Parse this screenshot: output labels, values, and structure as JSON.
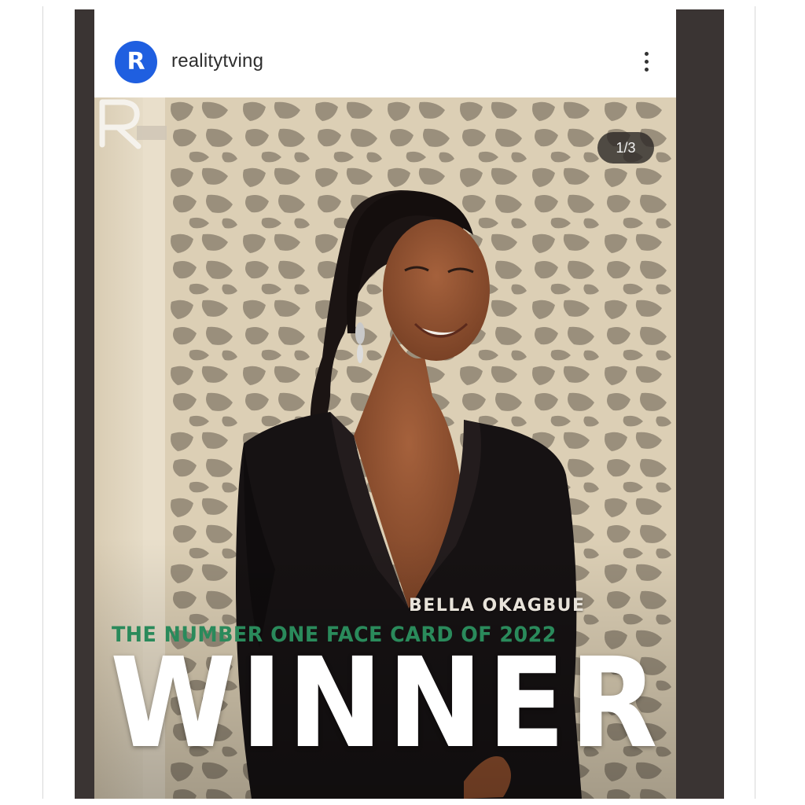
{
  "post": {
    "username": "realitytving",
    "avatar_letter": "R",
    "avatar_color": "#1f5fe0",
    "more_icon": "more-vertical-icon"
  },
  "media": {
    "slide_counter": "1/3",
    "name_caption": "BELLA OKAGBUE",
    "tagline": "THE NUMBER ONE FACE CARD OF 2022",
    "headline": "WINNER",
    "brand_mark_icon": "r-logo-icon",
    "tagline_color": "#2a8a5b"
  }
}
